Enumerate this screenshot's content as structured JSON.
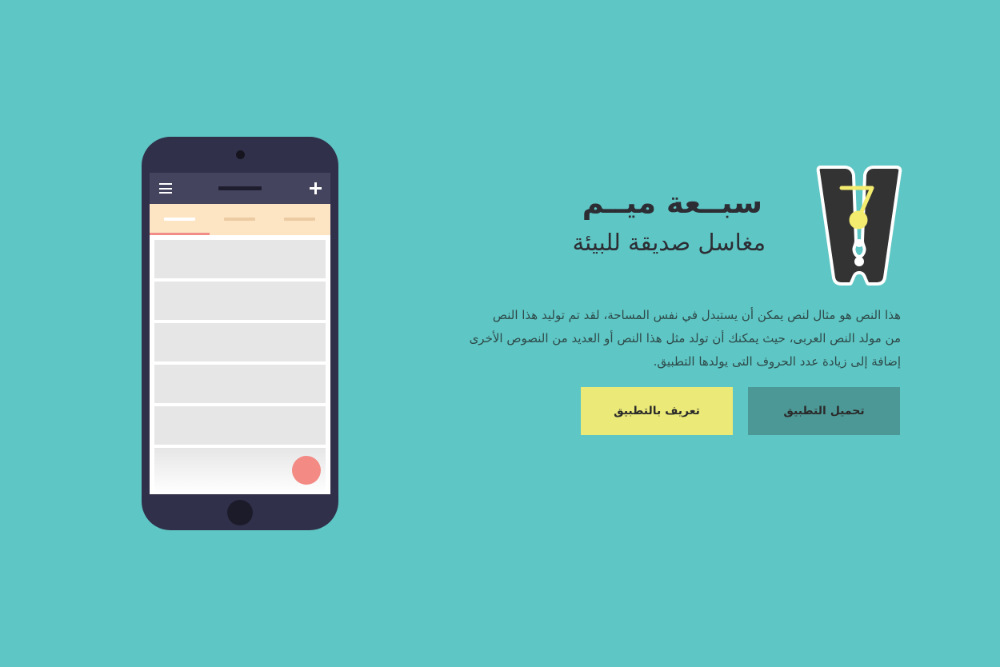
{
  "brand": {
    "title": "سبــعة ميــم",
    "subtitle": "مغاسل صديقة للبيئة",
    "logo_digit": "7"
  },
  "description": {
    "lines": [
      "هذا النص هو مثال لنص يمكن أن يستبدل في نفس المساحة، لقد تم توليد هذا النص",
      "من مولد النص العربى، حيث يمكنك أن تولد مثل هذا النص أو العديد من النصوص الأخرى",
      "إضافة إلى زيادة عدد الحروف التى يولدها التطبيق."
    ]
  },
  "buttons": {
    "download_label": "تحميل التطبيق",
    "about_label": "تعريف بالتطبيق"
  },
  "phone": {
    "icons": [
      "hamburger-menu-icon",
      "plus-icon"
    ],
    "tabs_count": 3,
    "active_tab": 1,
    "cards_count": 5
  },
  "colors": {
    "background": "#5ec6c4",
    "phone_body": "#31304a",
    "app_bar": "#45445f",
    "tab_bar": "#fde5c4",
    "tab_indicator": "#f08d87",
    "fab": "#f38a84",
    "button_download": "#4c9896",
    "button_about": "#ebe977",
    "logo_dark": "#333333",
    "logo_accent": "#f3ec6f"
  }
}
